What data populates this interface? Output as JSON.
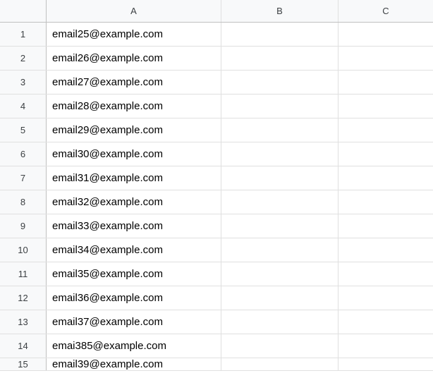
{
  "columns": [
    "A",
    "B",
    "C"
  ],
  "rows": [
    {
      "num": "1",
      "a": "email25@example.com",
      "b": "",
      "c": ""
    },
    {
      "num": "2",
      "a": "email26@example.com",
      "b": "",
      "c": ""
    },
    {
      "num": "3",
      "a": "email27@example.com",
      "b": "",
      "c": ""
    },
    {
      "num": "4",
      "a": "email28@example.com",
      "b": "",
      "c": ""
    },
    {
      "num": "5",
      "a": "email29@example.com",
      "b": "",
      "c": ""
    },
    {
      "num": "6",
      "a": "email30@example.com",
      "b": "",
      "c": ""
    },
    {
      "num": "7",
      "a": "email31@example.com",
      "b": "",
      "c": ""
    },
    {
      "num": "8",
      "a": "email32@example.com",
      "b": "",
      "c": ""
    },
    {
      "num": "9",
      "a": "email33@example.com",
      "b": "",
      "c": ""
    },
    {
      "num": "10",
      "a": "email34@example.com",
      "b": "",
      "c": ""
    },
    {
      "num": "11",
      "a": "email35@example.com",
      "b": "",
      "c": ""
    },
    {
      "num": "12",
      "a": "email36@example.com",
      "b": "",
      "c": ""
    },
    {
      "num": "13",
      "a": "email37@example.com",
      "b": "",
      "c": ""
    },
    {
      "num": "14",
      "a": "emai385@example.com",
      "b": "",
      "c": ""
    },
    {
      "num": "15",
      "a": "email39@example.com",
      "b": "",
      "c": ""
    }
  ]
}
